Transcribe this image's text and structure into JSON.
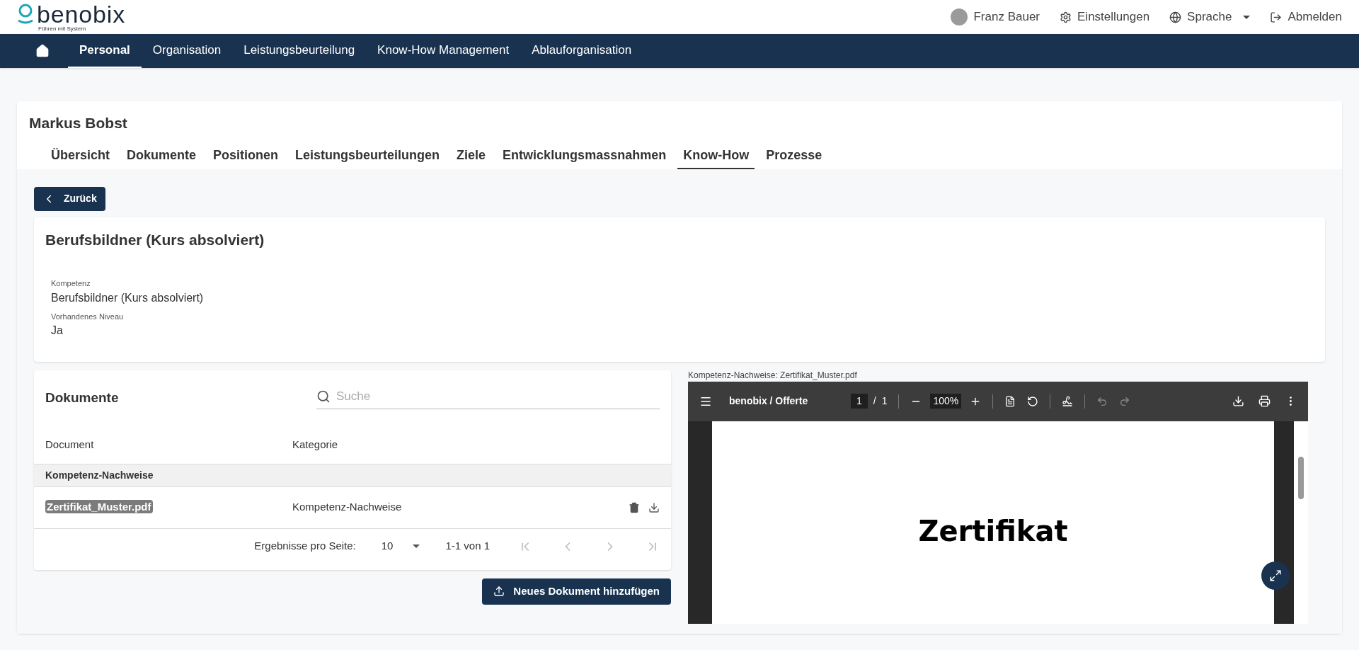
{
  "header": {
    "logo": "benobix",
    "tagline": "Führen mit System",
    "user": "Franz Bauer",
    "settings": "Einstellungen",
    "language": "Sprache",
    "logout": "Abmelden"
  },
  "nav": [
    {
      "label": "Personal",
      "selected": true
    },
    {
      "label": "Organisation",
      "selected": false
    },
    {
      "label": "Leistungsbeurteilung",
      "selected": false
    },
    {
      "label": "Know-How Management",
      "selected": false
    },
    {
      "label": "Ablauforganisation",
      "selected": false
    }
  ],
  "person": {
    "name": "Markus Bobst"
  },
  "tabs": [
    {
      "label": "Übersicht",
      "selected": false
    },
    {
      "label": "Dokumente",
      "selected": false
    },
    {
      "label": "Positionen",
      "selected": false
    },
    {
      "label": "Leistungsbeurteilungen",
      "selected": false
    },
    {
      "label": "Ziele",
      "selected": false
    },
    {
      "label": "Entwicklungsmassnahmen",
      "selected": false
    },
    {
      "label": "Know-How",
      "selected": true
    },
    {
      "label": "Prozesse",
      "selected": false
    }
  ],
  "back_button": "Zurück",
  "competence": {
    "title": "Berufsbildner (Kurs absolviert)",
    "fields": [
      {
        "label": "Kompetenz",
        "value": "Berufsbildner (Kurs absolviert)"
      },
      {
        "label": "Vorhandenes Niveau",
        "value": "Ja"
      }
    ]
  },
  "documents": {
    "title": "Dokumente",
    "search": {
      "placeholder": "Suche"
    },
    "columns": [
      "Document",
      "Kategorie"
    ],
    "group": "Kompetenz-Nachweise",
    "rows": [
      {
        "document": "Zertifikat_Muster.pdf",
        "category": "Kompetenz-Nachweise"
      }
    ],
    "pagination": {
      "label": "Ergebnisse pro Seite:",
      "page_size": "10",
      "range": "1-1 von 1"
    },
    "add_button": "Neues Dokument hinzufügen"
  },
  "viewer": {
    "caption": "Kompetenz-Nachweise: Zertifikat_Muster.pdf",
    "title": "benobix / Offerte",
    "page": "1",
    "separator": "/",
    "pages": "1",
    "zoom": "100%",
    "document_heading": "Zertifikat"
  }
}
